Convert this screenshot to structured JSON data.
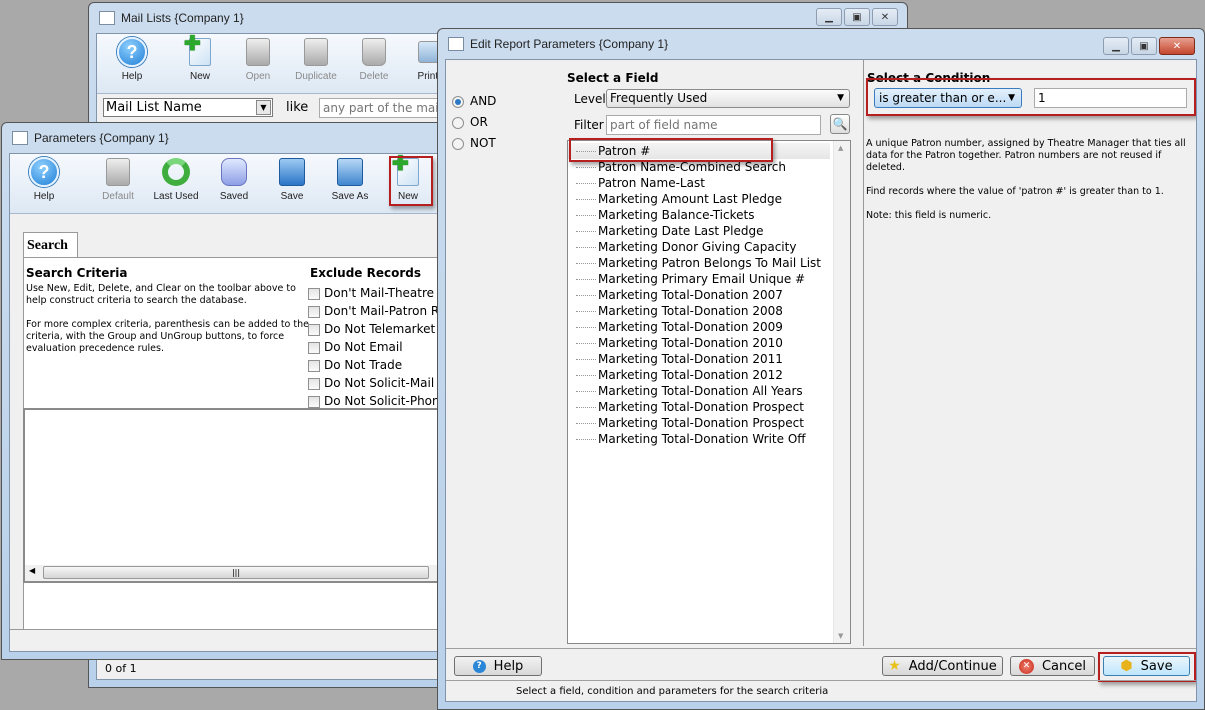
{
  "mail_lists_window": {
    "title": "Mail Lists {Company 1}",
    "toolbar": [
      {
        "label": "Help",
        "icon": "help-icon",
        "enabled": true
      },
      {
        "label": "New",
        "icon": "new-document-icon",
        "enabled": true
      },
      {
        "label": "Open",
        "icon": "magnifier-icon",
        "enabled": false
      },
      {
        "label": "Duplicate",
        "icon": "duplicate-icon",
        "enabled": false
      },
      {
        "label": "Delete",
        "icon": "trash-icon",
        "enabled": false
      },
      {
        "label": "Print...",
        "icon": "printer-icon",
        "enabled": true
      }
    ],
    "search_field": "Mail List Name",
    "search_op": "like",
    "search_placeholder": "any part of the mail",
    "status": "0 of 1"
  },
  "parameters_window": {
    "title": "Parameters {Company 1}",
    "toolbar": [
      {
        "label": "Help",
        "icon": "help-icon",
        "enabled": true
      },
      {
        "label": "Default",
        "icon": "pushpin-icon",
        "enabled": false
      },
      {
        "label": "Last Used",
        "icon": "refresh-icon",
        "enabled": true
      },
      {
        "label": "Saved",
        "icon": "database-search-icon",
        "enabled": true
      },
      {
        "label": "Save",
        "icon": "floppy-icon",
        "enabled": true
      },
      {
        "label": "Save As",
        "icon": "floppy-multiple-icon",
        "enabled": true
      },
      {
        "label": "New",
        "icon": "new-document-icon",
        "enabled": true
      }
    ],
    "tab": "Search",
    "search_criteria_heading": "Search Criteria",
    "help_text_1": "Use New, Edit, Delete, and Clear on the toolbar above to help construct criteria to search the database.",
    "help_text_2": "For more complex criteria, parenthesis can be added to the criteria, with the Group and UnGroup buttons, to force evaluation precedence rules.",
    "exclude_heading": "Exclude Records",
    "exclude_options": [
      "Don't Mail-Theatre",
      "Don't Mail-Patron R",
      "Do Not Telemarket",
      "Do Not Email",
      "Do Not Trade",
      "Do Not Solicit-Mail",
      "Do Not Solicit-Phon"
    ]
  },
  "edit_window": {
    "title": "Edit Report Parameters {Company 1}",
    "logic_options": [
      {
        "label": "AND",
        "selected": true
      },
      {
        "label": "OR",
        "selected": false
      },
      {
        "label": "NOT",
        "selected": false
      }
    ],
    "select_field_heading": "Select a Field",
    "level_label": "Level",
    "level_value": "Frequently Used",
    "filter_label": "Filter",
    "filter_placeholder": "part of field name",
    "fields": [
      "Patron #",
      "Patron Name-Combined Search",
      "Patron Name-Last",
      "Marketing Amount Last Pledge",
      "Marketing Balance-Tickets",
      "Marketing Date Last Pledge",
      "Marketing Donor Giving Capacity",
      "Marketing Patron Belongs To Mail List",
      "Marketing Primary Email Unique #",
      "Marketing Total-Donation 2007",
      "Marketing Total-Donation 2008",
      "Marketing Total-Donation 2009",
      "Marketing Total-Donation 2010",
      "Marketing Total-Donation 2011",
      "Marketing Total-Donation 2012",
      "Marketing Total-Donation All Years",
      "Marketing Total-Donation Prospect",
      "Marketing Total-Donation Prospect",
      "Marketing Total-Donation Write Off"
    ],
    "selected_field": "Patron #",
    "select_condition_heading": "Select a Condition",
    "condition_value": "is greater than or e...",
    "condition_input": "1",
    "description_1": "A unique Patron number, assigned by Theatre Manager that ties all data for the Patron together.  Patron numbers are not reused if deleted.",
    "description_2": "Find records where the value of 'patron #' is greater than to 1.",
    "description_3": "Note: this field is numeric.",
    "help_button": "Help",
    "add_continue_button": "Add/Continue",
    "cancel_button": "Cancel",
    "save_button": "Save",
    "status": "Select a field, condition and parameters for the search criteria"
  },
  "colors": {
    "highlight_box": "#b51f1f",
    "window_frame": "#b9d1ea"
  }
}
